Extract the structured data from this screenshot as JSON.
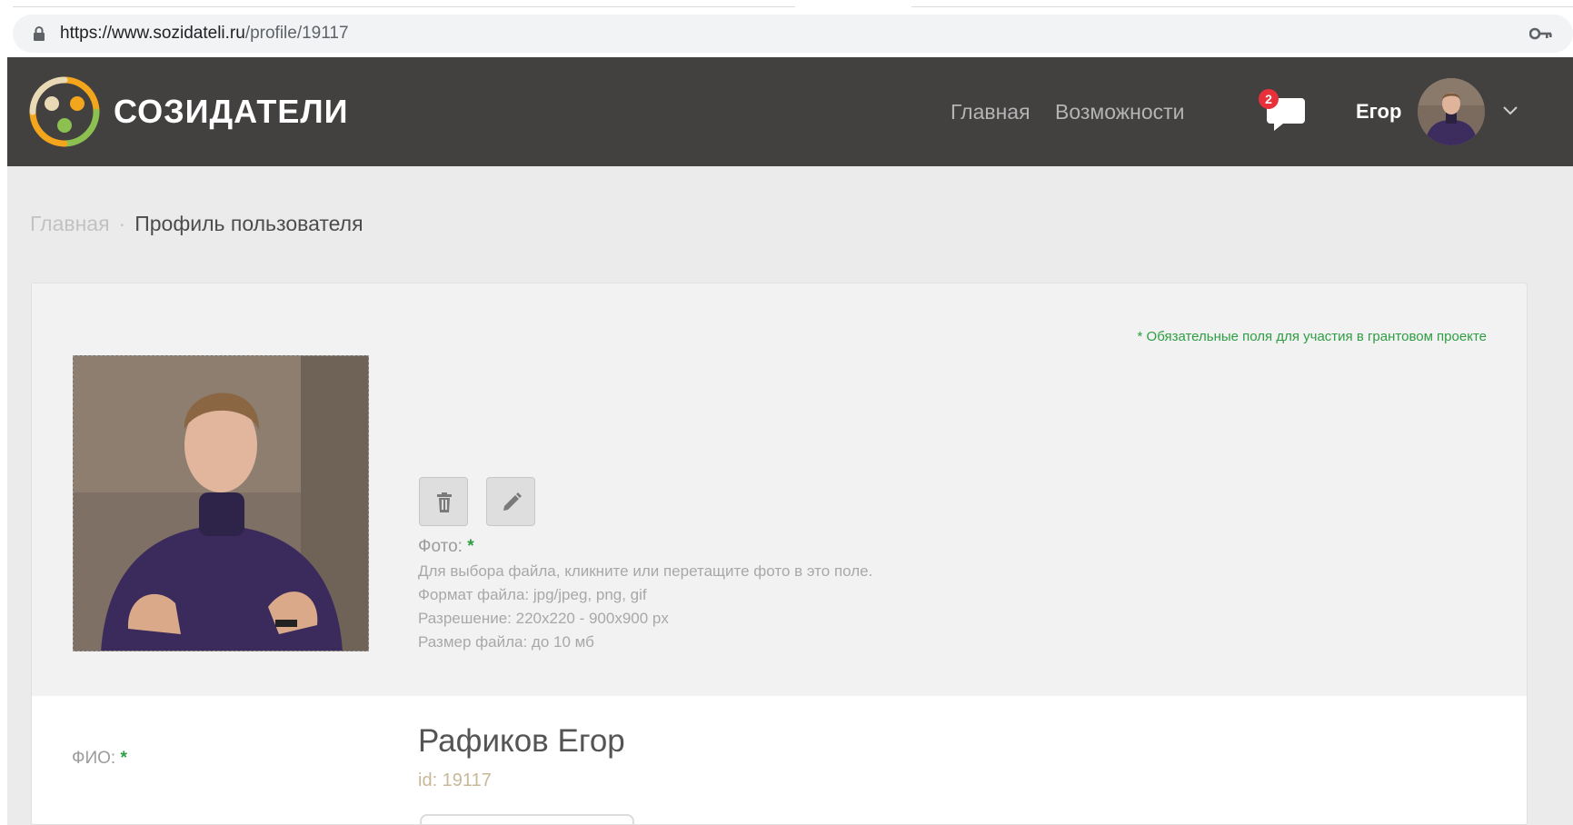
{
  "browser": {
    "url_main": "https://www.sozidateli.ru",
    "url_path": "/profile/19117",
    "lock_icon": "lock-icon",
    "key_icon": "key-icon"
  },
  "header": {
    "logo_text": "СОЗИДАТЕЛИ",
    "nav": [
      {
        "label": "Главная"
      },
      {
        "label": "Возможности"
      }
    ],
    "messages_badge": "2",
    "username": "Егор",
    "colors": {
      "header_bg": "#424140",
      "badge": "#e8303a",
      "logo_orange": "#f3a51c",
      "logo_green": "#8cc152"
    }
  },
  "breadcrumb": {
    "home": "Главная",
    "separator": "·",
    "current": "Профиль пользователя"
  },
  "profile": {
    "required_note": "* Обязательные поля для участия в грантовом проекте",
    "photo_label": "Фото:",
    "required_star": "*",
    "hints": [
      "Для выбора файла, кликните или перетащите фото в это поле.",
      "Формат файла: jpg/jpeg, png, gif",
      "Разрешение: 220x220 - 900x900 px",
      "Размер файла: до 10 мб"
    ],
    "fio_label": "ФИО:",
    "full_name": "Рафиков Егор",
    "user_id": "id: 19117",
    "accent_color": "#2e9e42"
  }
}
